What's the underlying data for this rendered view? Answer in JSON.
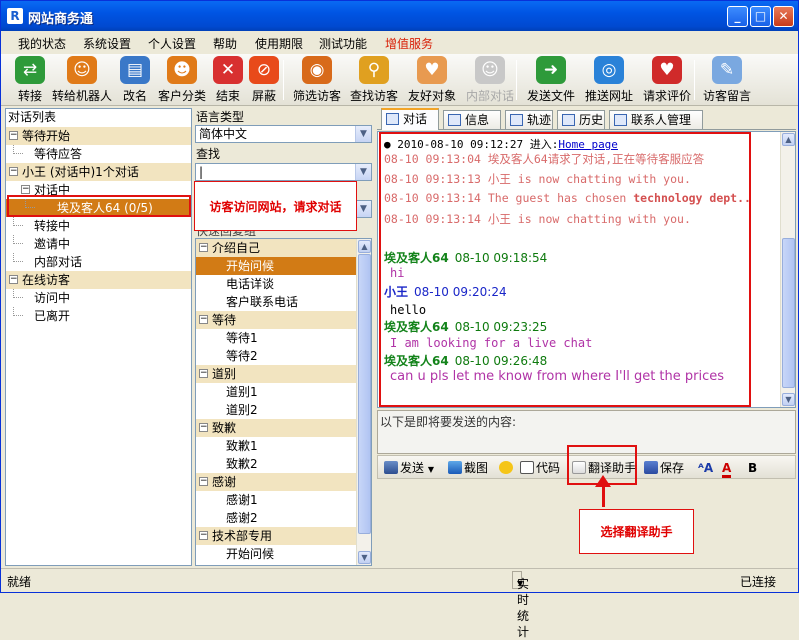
{
  "window": {
    "title": "网站商务通"
  },
  "menu": [
    "我的状态",
    "系统设置",
    "个人设置",
    "帮助",
    "使用期限",
    "测试功能",
    "增值服务"
  ],
  "menu_highlight_color": "#d81e06",
  "toolbar": [
    {
      "label": "转接",
      "icon": "transfer-icon"
    },
    {
      "label": "转给机器人",
      "icon": "robot-icon"
    },
    {
      "label": "改名",
      "icon": "rename-card-icon"
    },
    {
      "label": "客户分类",
      "icon": "customer-group-icon"
    },
    {
      "label": "结束",
      "icon": "end-icon"
    },
    {
      "label": "屏蔽",
      "icon": "block-icon"
    },
    {
      "label": "筛选访客",
      "icon": "filter-visitor-icon"
    },
    {
      "label": "查找访客",
      "icon": "find-visitor-icon"
    },
    {
      "label": "友好对象",
      "icon": "friend-icon"
    },
    {
      "label": "内部对话",
      "icon": "internal-chat-icon",
      "disabled": true
    },
    {
      "label": "发送文件",
      "icon": "send-file-icon"
    },
    {
      "label": "推送网址",
      "icon": "push-url-icon"
    },
    {
      "label": "请求评价",
      "icon": "rating-icon"
    },
    {
      "label": "访客留言",
      "icon": "visitor-message-icon"
    }
  ],
  "left": {
    "title": "对话列表",
    "tree": [
      {
        "label": "等待开始",
        "level": 0,
        "group": true,
        "box": "⊟"
      },
      {
        "label": "等待应答",
        "level": 1
      },
      {
        "label": "小王 (对话中)1个对话",
        "level": 0,
        "group": true,
        "box": "⊟"
      },
      {
        "label": "对话中",
        "level": 1,
        "box": "⊟"
      },
      {
        "label": "埃及客人64 (0/5)",
        "level": 2,
        "selected": true
      },
      {
        "label": "转接中",
        "level": 1
      },
      {
        "label": "邀请中",
        "level": 1
      },
      {
        "label": "内部对话",
        "level": 1
      },
      {
        "label": "在线访客",
        "level": 0,
        "group": true,
        "box": "⊟"
      },
      {
        "label": "访问中",
        "level": 1
      },
      {
        "label": "已离开",
        "level": 1
      }
    ]
  },
  "mid": {
    "lang_label": "语言类型",
    "lang_value": "简体中文",
    "search_label": "查找",
    "search_value": "|",
    "hidden_row": "快速回复组",
    "phrases": [
      {
        "label": "介绍自己",
        "group": true
      },
      {
        "label": "开始问候",
        "selected": true
      },
      {
        "label": "电话详谈"
      },
      {
        "label": "客户联系电话"
      },
      {
        "label": "等待",
        "group": true
      },
      {
        "label": "等待1"
      },
      {
        "label": "等待2"
      },
      {
        "label": "道别",
        "group": true
      },
      {
        "label": "道别1"
      },
      {
        "label": "道别2"
      },
      {
        "label": "致歉",
        "group": true
      },
      {
        "label": "致歉1"
      },
      {
        "label": "致歉2"
      },
      {
        "label": "感谢",
        "group": true
      },
      {
        "label": "感谢1"
      },
      {
        "label": "感谢2"
      },
      {
        "label": "技术部专用",
        "group": true
      },
      {
        "label": "开始问候"
      }
    ]
  },
  "tabs": [
    {
      "label": "对话",
      "active": true
    },
    {
      "label": "信息"
    },
    {
      "label": "轨迹"
    },
    {
      "label": "历史"
    },
    {
      "label": "联系人管理"
    }
  ],
  "chat": {
    "first_line": {
      "prefix": "● 2010-08-10 09:12:27 进入:",
      "link": "Home page"
    },
    "system_lines": [
      {
        "text": "08-10 09:13:04  埃及客人64请求了对话,正在等待客服应答"
      },
      {
        "text": "08-10 09:13:13  小王 is now chatting with you."
      },
      {
        "text": "08-10 09:13:14  The guest has chosen ",
        "highlight": "technology dept.."
      },
      {
        "text": "08-10 09:13:14  小王 is now chatting with you."
      }
    ],
    "messages": [
      {
        "sender": "埃及客人64",
        "time": "08-10 09:18:54",
        "text": "hi",
        "who": "visitor"
      },
      {
        "sender": "小王",
        "time": "08-10 09:20:24",
        "text": "hello",
        "who": "agent"
      },
      {
        "sender": "埃及客人64",
        "time": "08-10 09:23:25",
        "text": "I am looking for a live chat",
        "who": "visitor"
      },
      {
        "sender": "埃及客人64",
        "time": "08-10 09:26:48",
        "text": "can u pls let me know from where I'll get the prices",
        "who": "visitor"
      }
    ]
  },
  "input": {
    "label": "以下是即将要发送的内容:"
  },
  "bottom_toolbar": {
    "send": "发送",
    "screenshot": "截图",
    "code": "代码",
    "translate": "翻译助手",
    "save": "保存",
    "bold": "B"
  },
  "annotations": {
    "visitor_note": "访客访问网站，请求对话",
    "translate_note": "选择翻译助手"
  },
  "status": {
    "left": "就绪",
    "middle": "实时统计",
    "right": "已连接"
  }
}
